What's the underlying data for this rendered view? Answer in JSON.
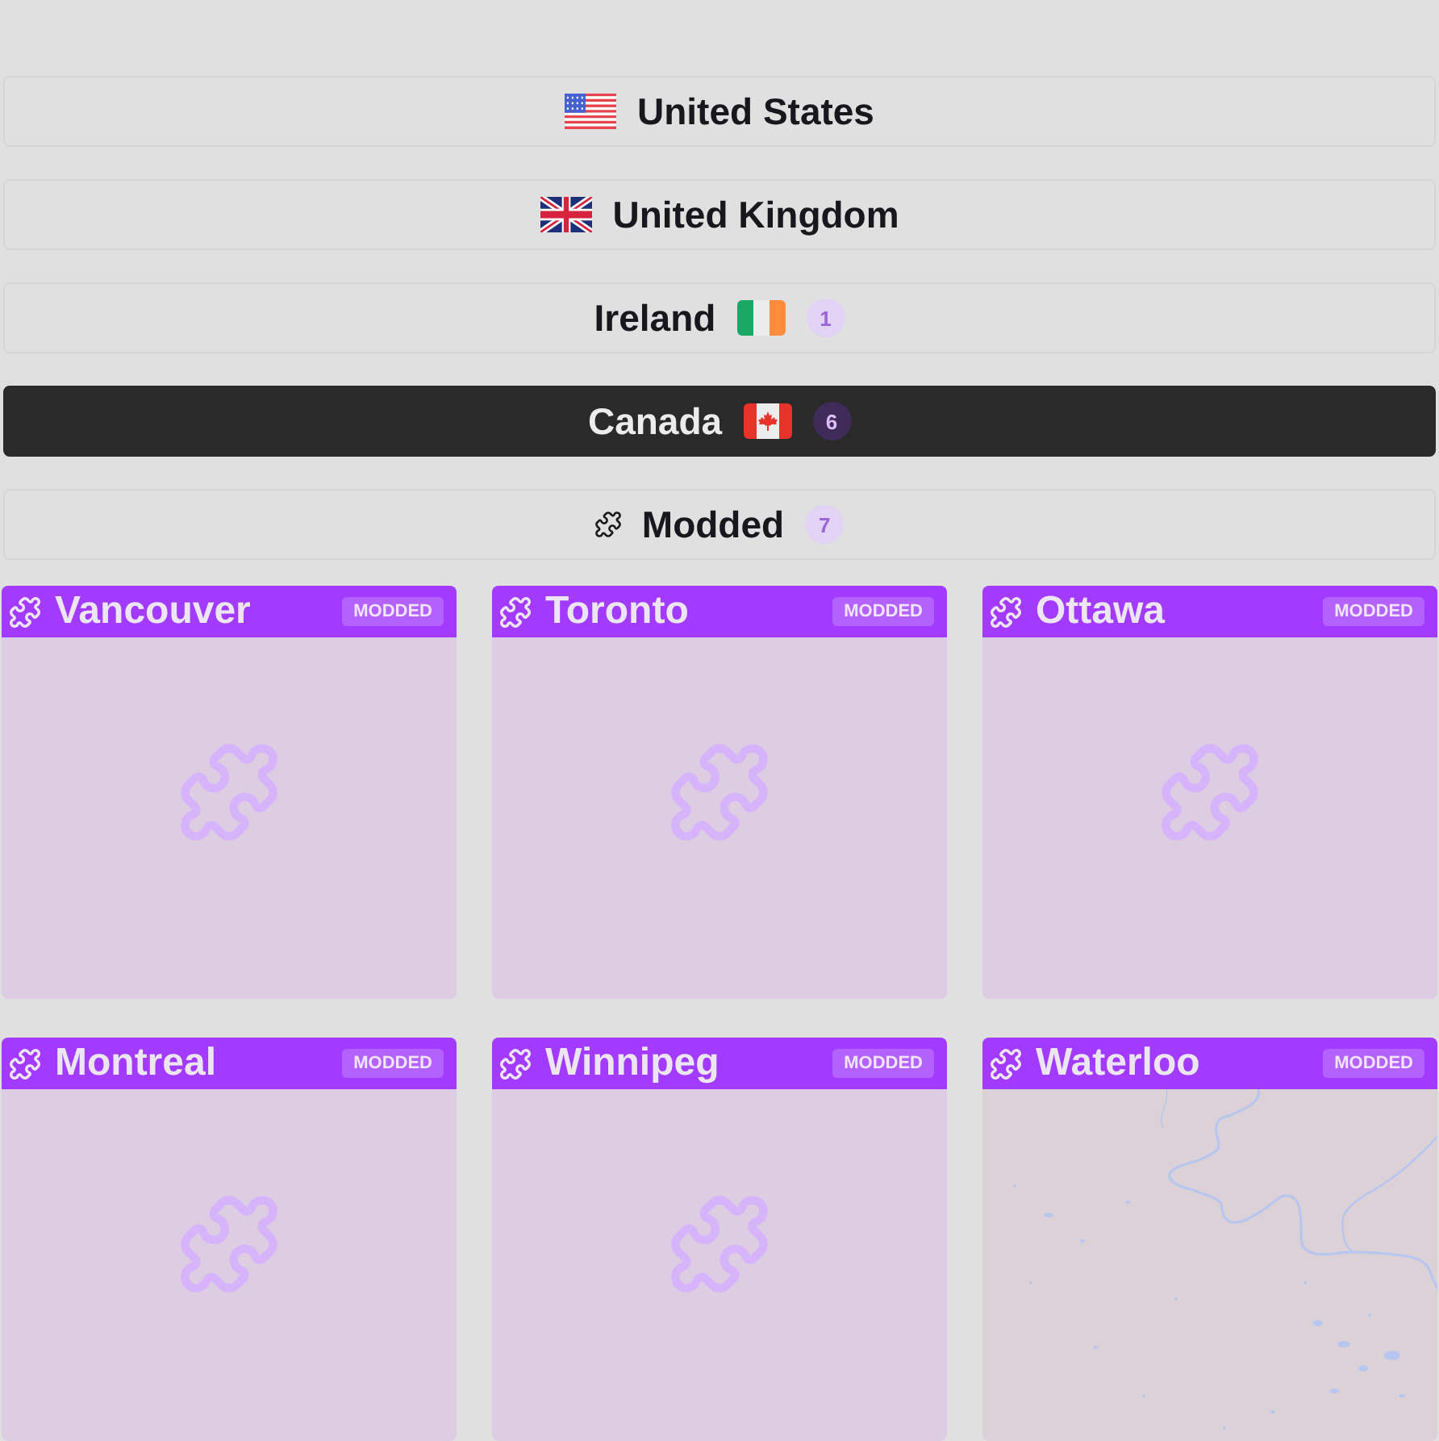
{
  "countries": [
    {
      "name": "United States",
      "kind": "us",
      "selected": false
    },
    {
      "name": "United Kingdom",
      "kind": "uk",
      "selected": false
    },
    {
      "name": "Ireland",
      "kind": "ie",
      "count": "1",
      "selected": false
    },
    {
      "name": "Canada",
      "kind": "ca",
      "count": "6",
      "selected": true
    },
    {
      "name": "Modded",
      "kind": "modded",
      "count": "7",
      "selected": false
    }
  ],
  "cards": [
    {
      "title": "Vancouver",
      "badge": "MODDED",
      "kind": "placeholder"
    },
    {
      "title": "Toronto",
      "badge": "MODDED",
      "kind": "placeholder"
    },
    {
      "title": "Ottawa",
      "badge": "MODDED",
      "kind": "placeholder"
    },
    {
      "title": "Montreal",
      "badge": "MODDED",
      "kind": "placeholder"
    },
    {
      "title": "Winnipeg",
      "badge": "MODDED",
      "kind": "placeholder"
    },
    {
      "title": "Waterloo",
      "badge": "MODDED",
      "kind": "map"
    }
  ]
}
